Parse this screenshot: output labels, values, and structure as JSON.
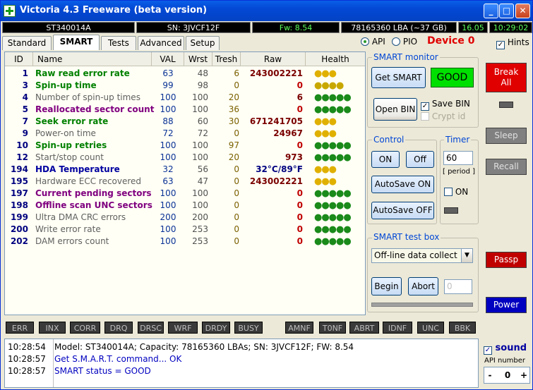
{
  "window": {
    "title": "Victoria 4.3 Freeware (beta version)",
    "min": "_",
    "max": "□",
    "close": "✕"
  },
  "infobar": {
    "model": "ST340014A",
    "serial": "SN: 3JVCF12F",
    "firmware": "Fw: 8.54",
    "capacity": "78165360 LBA (~37 GB)",
    "date": "16.05",
    "time": "10:29:02"
  },
  "tabs": [
    "Standard",
    "SMART",
    "Tests",
    "Advanced",
    "Setup"
  ],
  "mode": {
    "api": "API",
    "pio": "PIO",
    "selected": "API"
  },
  "device": "Device 0",
  "hints": {
    "label": "Hints",
    "checked": true
  },
  "table": {
    "headers": [
      "ID",
      "Name",
      "VAL",
      "Wrst",
      "Tresh",
      "Raw",
      "Health"
    ],
    "rows": [
      {
        "id": "1",
        "name": "Raw read error rate",
        "val": "63",
        "wrst": "48",
        "tresh": "6",
        "raw": "243002221",
        "health": "●●●",
        "health_count": 3
      },
      {
        "id": "3",
        "name": "Spin-up time",
        "val": "99",
        "wrst": "98",
        "tresh": "0",
        "raw": "0",
        "health": "●●●●",
        "health_count": 4
      },
      {
        "id": "4",
        "name": "Number of spin-up times",
        "val": "100",
        "wrst": "100",
        "tresh": "20",
        "raw": "6",
        "health": "●●●●●",
        "health_count": 5
      },
      {
        "id": "5",
        "name": "Reallocated sector count",
        "val": "100",
        "wrst": "100",
        "tresh": "36",
        "raw": "0",
        "health": "●●●●●",
        "health_count": 5
      },
      {
        "id": "7",
        "name": "Seek error rate",
        "val": "88",
        "wrst": "60",
        "tresh": "30",
        "raw": "671241705",
        "health": "●●●",
        "health_count": 3
      },
      {
        "id": "9",
        "name": "Power-on time",
        "val": "72",
        "wrst": "72",
        "tresh": "0",
        "raw": "24967",
        "health": "●●●",
        "health_count": 3
      },
      {
        "id": "10",
        "name": "Spin-up retries",
        "val": "100",
        "wrst": "100",
        "tresh": "97",
        "raw": "0",
        "health": "●●●●●",
        "health_count": 5
      },
      {
        "id": "12",
        "name": "Start/stop count",
        "val": "100",
        "wrst": "100",
        "tresh": "20",
        "raw": "973",
        "health": "●●●●●",
        "health_count": 5
      },
      {
        "id": "194",
        "name": "HDA Temperature",
        "val": "32",
        "wrst": "56",
        "tresh": "0",
        "raw": "32°C/89°F",
        "health": "●●●",
        "health_count": 3
      },
      {
        "id": "195",
        "name": "Hardware ECC recovered",
        "val": "63",
        "wrst": "47",
        "tresh": "0",
        "raw": "243002221",
        "health": "●●●",
        "health_count": 3
      },
      {
        "id": "197",
        "name": "Current pending sectors",
        "val": "100",
        "wrst": "100",
        "tresh": "0",
        "raw": "0",
        "health": "●●●●●",
        "health_count": 5
      },
      {
        "id": "198",
        "name": "Offline scan UNC sectors",
        "val": "100",
        "wrst": "100",
        "tresh": "0",
        "raw": "0",
        "health": "●●●●●",
        "health_count": 5
      },
      {
        "id": "199",
        "name": "Ultra DMA CRC errors",
        "val": "200",
        "wrst": "200",
        "tresh": "0",
        "raw": "0",
        "health": "●●●●●",
        "health_count": 5
      },
      {
        "id": "200",
        "name": "Write error rate",
        "val": "100",
        "wrst": "253",
        "tresh": "0",
        "raw": "0",
        "health": "●●●●●",
        "health_count": 5
      },
      {
        "id": "202",
        "name": "DAM errors count",
        "val": "100",
        "wrst": "253",
        "tresh": "0",
        "raw": "0",
        "health": "●●●●●",
        "health_count": 5
      }
    ]
  },
  "smart_monitor": {
    "title": "SMART monitor",
    "get_smart": "Get SMART",
    "status": "GOOD",
    "open_bin": "Open BIN",
    "save_bin": "Save BIN",
    "save_bin_checked": true,
    "crypt_id": "Crypt id",
    "crypt_id_checked": false
  },
  "control": {
    "title": "Control",
    "on": "ON",
    "off": "Off",
    "autosave_on": "AutoSave ON",
    "autosave_off": "AutoSave OFF"
  },
  "timer": {
    "title": "Timer",
    "value": "60",
    "period": "[ period ]",
    "on_label": "ON",
    "on_checked": false
  },
  "smart_test": {
    "title": "SMART test box",
    "selected": "Off-line data collect",
    "begin": "Begin",
    "abort": "Abort",
    "value": "0"
  },
  "right_buttons": {
    "break_all": "Break All",
    "sleep": "Sleep",
    "recall": "Recall",
    "passp": "Passp",
    "power": "Power"
  },
  "flags": [
    "ERR",
    "INX",
    "CORR",
    "DRQ",
    "DRSC",
    "WRF",
    "DRDY",
    "BUSY",
    "AMNF",
    "T0NF",
    "ABRT",
    "IDNF",
    "UNC",
    "BBK"
  ],
  "log": [
    {
      "time": "10:28:54",
      "text": "Model: ST340014A; Capacity: 78165360 LBAs; SN: 3JVCF12F; FW: 8.54",
      "color": "#000000"
    },
    {
      "time": "10:28:57",
      "text": "Get S.M.A.R.T. command... OK",
      "color": "#0000c0"
    },
    {
      "time": "10:28:57",
      "text": "SMART status = GOOD",
      "color": "#0000c0"
    }
  ],
  "sound": {
    "label": "sound",
    "checked": true,
    "api_label": "API number",
    "api_value": "0",
    "minus": "-",
    "plus": "+"
  },
  "colors": {
    "good": "#00e000",
    "break": "#e00000",
    "passp": "#c00000",
    "power": "#0000c0",
    "title_bar": "#0348d4"
  }
}
